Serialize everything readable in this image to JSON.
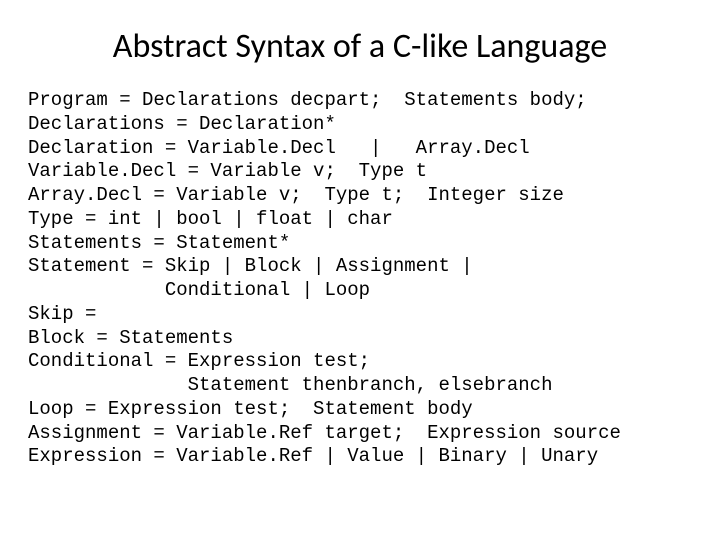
{
  "title": "Abstract Syntax of a C-like Language",
  "lines": [
    "Program = Declarations decpart;  Statements body;",
    "Declarations = Declaration*",
    "Declaration = Variable.Decl   |   Array.Decl",
    "Variable.Decl = Variable v;  Type t",
    "Array.Decl = Variable v;  Type t;  Integer size",
    "Type = int | bool | float | char",
    "Statements = Statement*",
    "Statement = Skip | Block | Assignment |",
    "            Conditional | Loop",
    "Skip =",
    "Block = Statements",
    "Conditional = Expression test;",
    "              Statement thenbranch, elsebranch",
    "Loop = Expression test;  Statement body",
    "Assignment = Variable.Ref target;  Expression source",
    "Expression = Variable.Ref | Value | Binary | Unary"
  ]
}
